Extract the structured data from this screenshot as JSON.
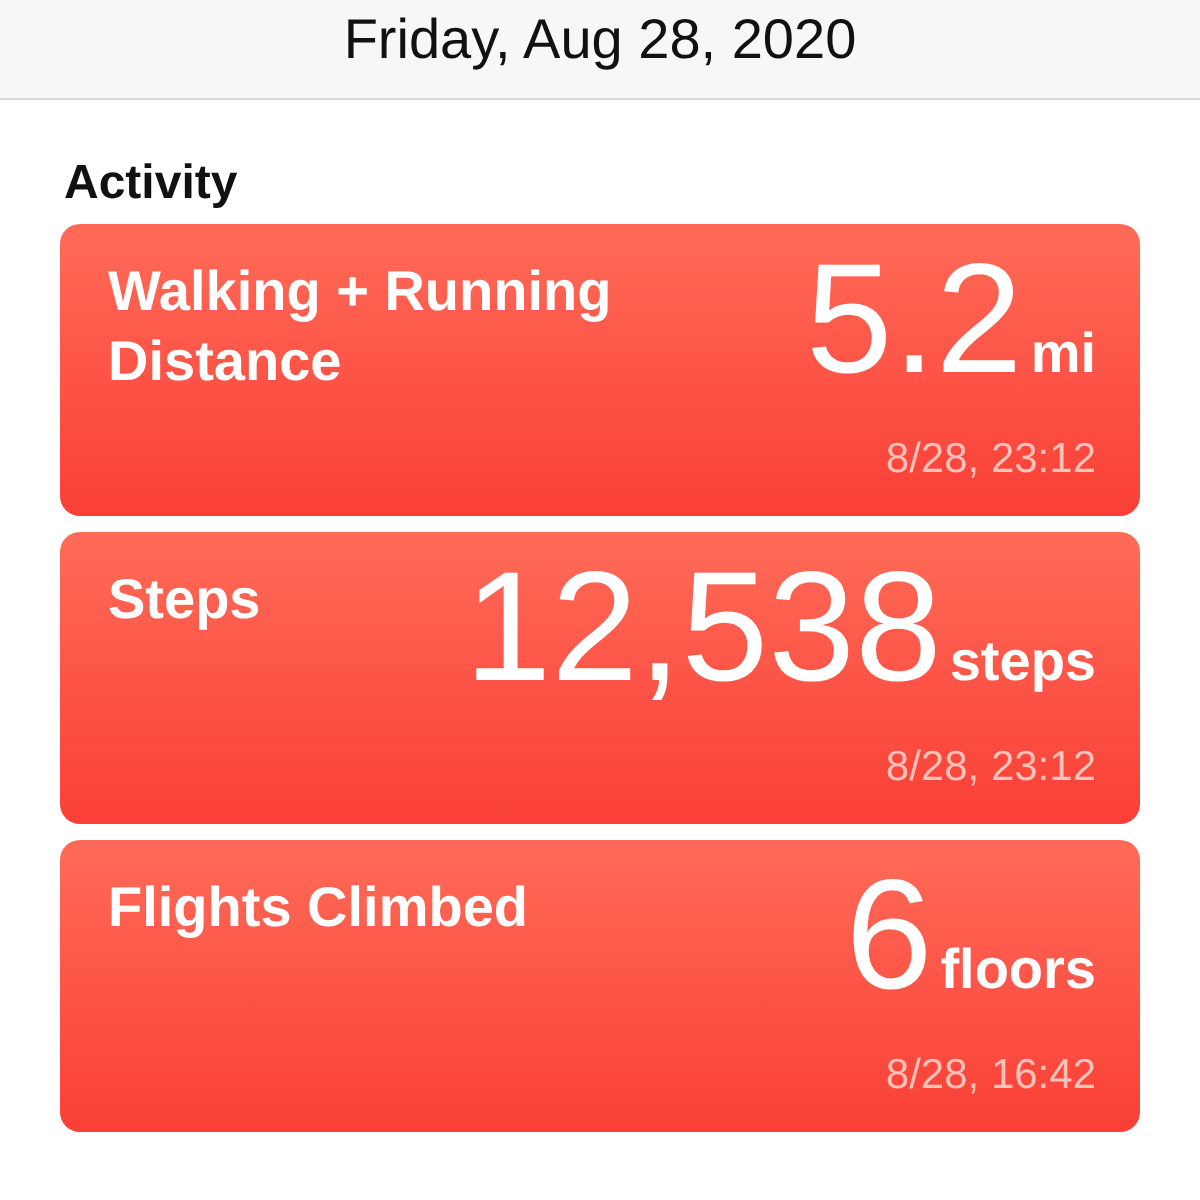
{
  "header": {
    "title": "Friday, Aug 28, 2020"
  },
  "section": {
    "title": "Activity"
  },
  "cards": [
    {
      "title": "Walking + Running Distance",
      "value": "5.2",
      "unit": "mi",
      "date": "8/28, 23:12"
    },
    {
      "title": "Steps",
      "value": "12,538",
      "unit": "steps",
      "date": "8/28, 23:12"
    },
    {
      "title": "Flights Climbed",
      "value": "6",
      "unit": "floors",
      "date": "8/28, 16:42"
    }
  ]
}
